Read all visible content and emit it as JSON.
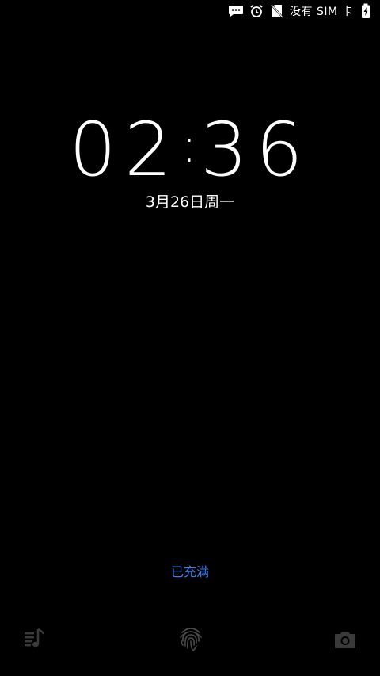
{
  "status_bar": {
    "icons": [
      "message-icon",
      "alarm-icon",
      "no-sim-icon",
      "battery-charging-icon"
    ],
    "sim_status": "没有 SIM 卡"
  },
  "lockscreen": {
    "time_hours": "02",
    "time_separator": ":",
    "time_minutes": "36",
    "date": "3月26日周一",
    "charge_status": "已充满"
  },
  "shortcuts": {
    "left": "music-icon",
    "center": "fingerprint-icon",
    "right": "camera-icon"
  },
  "colors": {
    "background": "#000000",
    "text": "#ffffff",
    "accent": "#3d7ee8",
    "dim_icon": "#3a3a3a"
  }
}
